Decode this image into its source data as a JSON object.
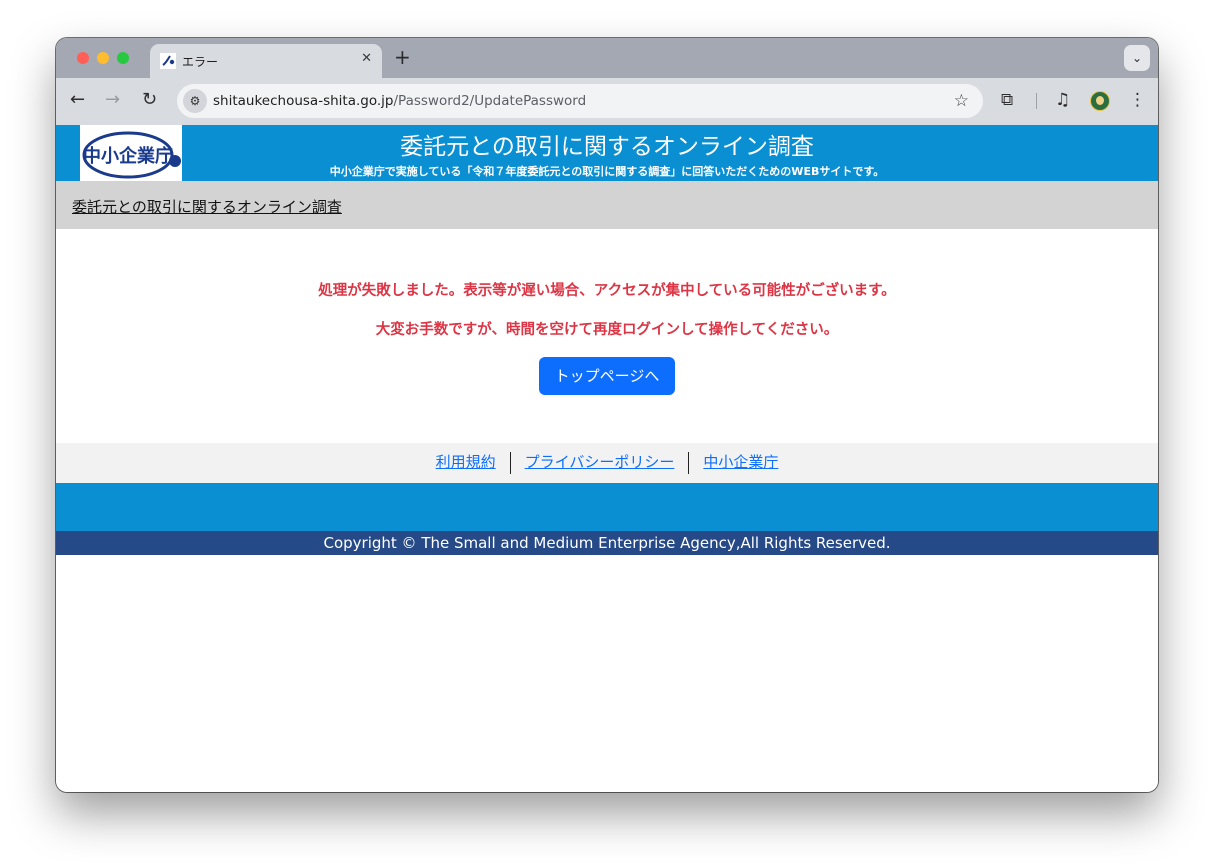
{
  "browser": {
    "tab_title": "エラー",
    "tab_close": "✕",
    "new_tab": "+",
    "url_host": "shitaukechousa-shita.go.jp",
    "url_path": "/Password2/UpdatePassword",
    "icons": [
      "back-arrow-icon",
      "forward-arrow-icon",
      "reload-icon",
      "site-settings-icon",
      "bookmark-star-icon",
      "extensions-icon",
      "media-controls-icon",
      "profile-avatar-icon",
      "more-menu-icon",
      "tab-search-icon"
    ]
  },
  "header": {
    "logo_text": "中小企業庁",
    "title": "委託元との取引に関するオンライン調査",
    "subtitle": "中小企業庁で実施している「令和７年度委託元との取引に関する調査」に回答いただくためのWEBサイトです。"
  },
  "breadcrumb": {
    "link": "委託元との取引に関するオンライン調査"
  },
  "main": {
    "error_line1": "処理が失敗しました。表示等が遅い場合、アクセスが集中している可能性がございます。",
    "error_line2": "大変お手数ですが、時間を空けて再度ログインして操作してください。",
    "top_button": "トップページへ"
  },
  "footer": {
    "links": [
      "利用規約",
      "プライバシーポリシー",
      "中小企業庁"
    ],
    "copyright": "Copyright © The Small and Medium Enterprise Agency,All Rights Reserved."
  },
  "colors": {
    "header_blue": "#0b8fd3",
    "footer_navy": "#264a87",
    "error_red": "#dc3545",
    "button_blue": "#0d6efd"
  }
}
